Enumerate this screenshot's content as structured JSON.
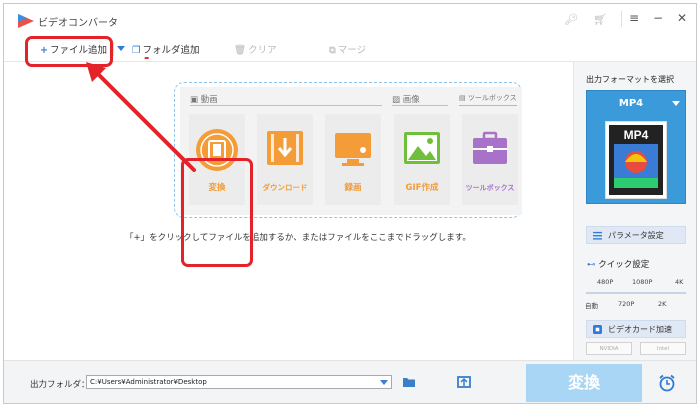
{
  "app": {
    "title": "ビデオコンバータ"
  },
  "toolbar": {
    "add_file": "ファイル追加",
    "add_folder": "フォルダ追加",
    "clear": "クリア",
    "merge": "マージ"
  },
  "annotation": {
    "mark": "-"
  },
  "sections": {
    "video": "動画",
    "image": "画像",
    "toolbox": "ツールボックス"
  },
  "tiles": [
    {
      "label": "変換",
      "color": "#f39c38"
    },
    {
      "label": "ダウンロード",
      "color": "#f39c38"
    },
    {
      "label": "録画",
      "color": "#f39c38"
    },
    {
      "label": "GIF作成",
      "color": "#f39c38"
    },
    {
      "label": "ツールボックス",
      "color": "#a872c9"
    }
  ],
  "hint": "「+」をクリックしてファイルを追加するか、またはファイルをここまでドラッグします。",
  "right_panel": {
    "title": "出力フォーマットを選択",
    "format": "MP4",
    "format_thumb_label": "MP4",
    "params_button": "パラメータ設定",
    "quick_settings": "クイック設定",
    "scale_top": [
      "480P",
      "1080P",
      "4K"
    ],
    "scale_bottom": [
      "自動",
      "720P",
      "2K"
    ],
    "gpu_button": "ビデオカード加速",
    "chips": [
      "NVIDIA",
      "Intel"
    ]
  },
  "bottom": {
    "output_label": "出力フォルダ：",
    "output_path": "C:¥Users¥Administrator¥Desktop",
    "convert": "変換"
  },
  "colors": {
    "accent": "#2f7bd6",
    "annotation": "#e3222a",
    "tile_orange": "#f39c38",
    "convert_button": "#a9d6f5"
  }
}
